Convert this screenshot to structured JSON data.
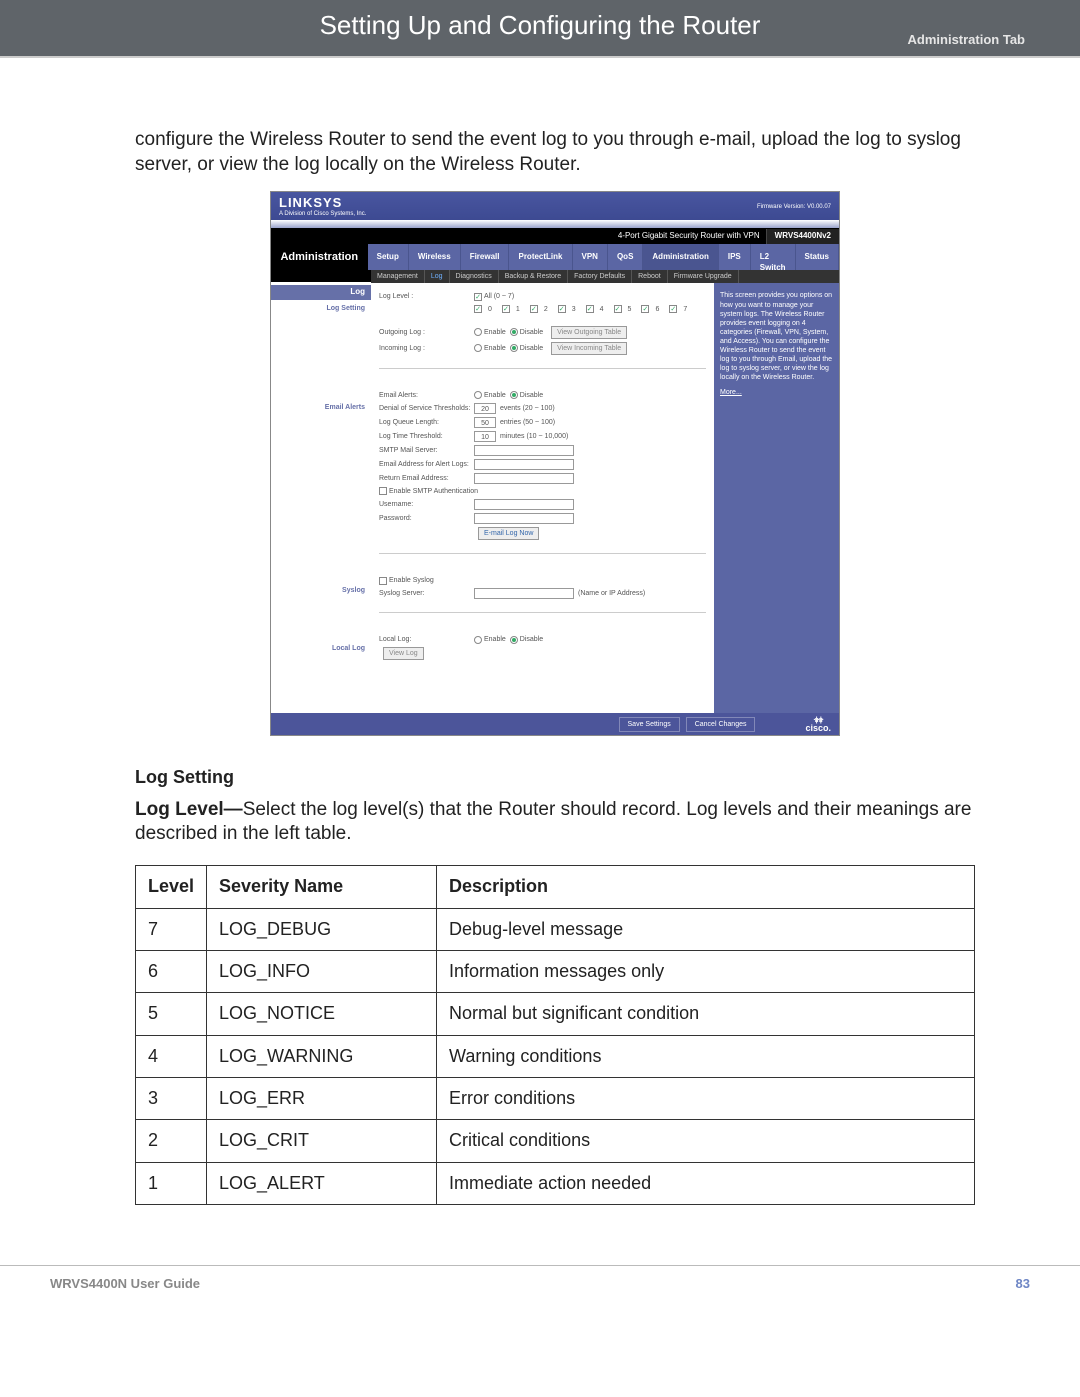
{
  "header": {
    "title": "Setting Up and Configuring the Router",
    "subtitle": "Administration Tab"
  },
  "intro_paragraph": "configure the Wireless Router to send the event log to you through e-mail, upload the log to syslog server, or view the log locally on the Wireless Router.",
  "screenshot": {
    "brand": "LINKSYS",
    "brand_sub": "A Division of Cisco Systems, Inc.",
    "firmware": "Firmware Version: V0.00.07",
    "product": "4-Port Gigabit Security Router with VPN",
    "model": "WRVS4400Nv2",
    "current_section": "Administration",
    "tabs": [
      "Setup",
      "Wireless",
      "Firewall",
      "ProtectLink",
      "VPN",
      "QoS",
      "Administration",
      "IPS",
      "L2 Switch",
      "Status"
    ],
    "subnav": [
      "Management",
      "Log",
      "Diagnostics",
      "Backup & Restore",
      "Factory Defaults",
      "Reboot",
      "Firmware Upgrade"
    ],
    "subnav_active": "Log",
    "section_labels": {
      "log": "Log",
      "log_setting": "Log Setting",
      "email": "Email Alerts",
      "syslog": "Syslog",
      "local": "Local Log"
    },
    "fields": {
      "log_level_label": "Log Level :",
      "log_level_all": "All (0 ~ 7)",
      "level_checks": [
        "0",
        "1",
        "2",
        "3",
        "4",
        "5",
        "6",
        "7"
      ],
      "outgoing_label": "Outgoing Log :",
      "incoming_label": "Incoming Log :",
      "enable": "Enable",
      "disable": "Disable",
      "view_out": "View Outgoing Table",
      "view_in": "View Incoming Table",
      "email_alerts": "Email Alerts:",
      "dos": "Denial of Service Thresholds:",
      "dos_val": "20",
      "dos_hint": "events (20 ~ 100)",
      "queue": "Log Queue Length:",
      "queue_val": "50",
      "queue_hint": "entries (50 ~ 100)",
      "time": "Log Time Threshold:",
      "time_val": "10",
      "time_hint": "minutes (10 ~ 10,000)",
      "smtp": "SMTP Mail Server:",
      "alert_addr": "Email Address for Alert Logs:",
      "return_addr": "Return Email Address:",
      "smtp_auth": "Enable SMTP Authentication",
      "user": "Username:",
      "pass": "Password:",
      "email_now": "E-mail Log Now",
      "enable_syslog": "Enable Syslog",
      "syslog_server": "Syslog Server:",
      "syslog_hint": "(Name or IP Address)",
      "local_log": "Local Log:",
      "view_log": "View Log",
      "save": "Save Settings",
      "cancel": "Cancel Changes"
    },
    "help_text": "This screen provides you options on how you want to manage your system logs. The Wireless Router provides event logging on 4 categories (Firewall, VPN, System, and Access). You can configure the Wireless Router to send the event log to you through Email, upload the log to syslog server, or view the log locally on the Wireless Router.",
    "help_more": "More...",
    "cisco_name": "cisco."
  },
  "section_heading": "Log Setting",
  "loglevel_bold": "Log Level—",
  "loglevel_text": "Select the log level(s) that the Router should record. Log levels and their meanings are described in the left table.",
  "table": {
    "headers": [
      "Level",
      "Severity Name",
      "Description"
    ],
    "rows": [
      {
        "level": "7",
        "name": "LOG_DEBUG",
        "desc": "Debug-level message"
      },
      {
        "level": "6",
        "name": "LOG_INFO",
        "desc": "Information messages only"
      },
      {
        "level": "5",
        "name": "LOG_NOTICE",
        "desc": "Normal but significant condition"
      },
      {
        "level": "4",
        "name": "LOG_WARNING",
        "desc": "Warning conditions"
      },
      {
        "level": "3",
        "name": "LOG_ERR",
        "desc": "Error conditions"
      },
      {
        "level": "2",
        "name": "LOG_CRIT",
        "desc": "Critical conditions"
      },
      {
        "level": "1",
        "name": "LOG_ALERT",
        "desc": "Immediate action needed"
      }
    ]
  },
  "footer": {
    "guide": "WRVS4400N User Guide",
    "page": "83"
  }
}
